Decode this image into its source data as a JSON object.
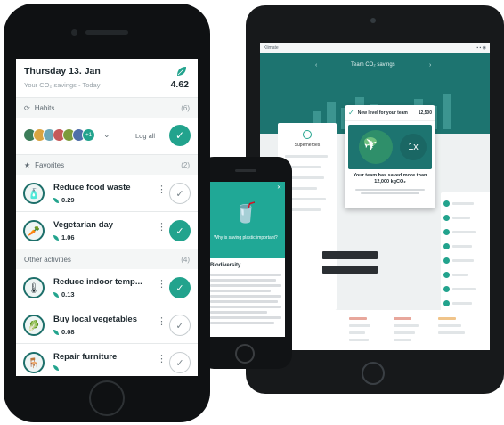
{
  "main_phone": {
    "date": "Thursday 13. Jan",
    "savings_label": "Your CO₂ savings - Today",
    "savings_value": "4.62",
    "habits": {
      "label": "Habits",
      "count": "(6)",
      "extra_count": "+1",
      "log_all": "Log all"
    },
    "favorites": {
      "label": "Favorites",
      "count": "(2)",
      "items": [
        {
          "title": "Reduce food waste",
          "value": "0.29",
          "done": false,
          "icon": "bottle-icon"
        },
        {
          "title": "Vegetarian day",
          "value": "1.06",
          "done": true,
          "icon": "carrot-icon"
        }
      ]
    },
    "other": {
      "label": "Other activities",
      "count": "(4)",
      "items": [
        {
          "title": "Reduce indoor temp...",
          "value": "0.13",
          "done": true,
          "icon": "thermometer-icon"
        },
        {
          "title": "Buy local vegetables",
          "value": "0.08",
          "done": false,
          "icon": "vegetable-icon"
        },
        {
          "title": "Repair furniture",
          "value": "",
          "done": false,
          "icon": "chair-icon"
        }
      ]
    }
  },
  "small_phone": {
    "question": "Why is saving plastic important?",
    "section": "Biodiversity"
  },
  "tablet": {
    "brand": "Klimate",
    "chart_title": "Team CO₂ savings",
    "side_title": "Superheroes",
    "modal": {
      "badge": "New level for your team",
      "number": "12,500",
      "multiplier": "1x",
      "headline": "Your team has saved more than 12,000 kgCO₂"
    }
  },
  "colors": {
    "accent": "#22a38d",
    "dark_teal": "#1d7470",
    "text": "#1f2a30"
  }
}
